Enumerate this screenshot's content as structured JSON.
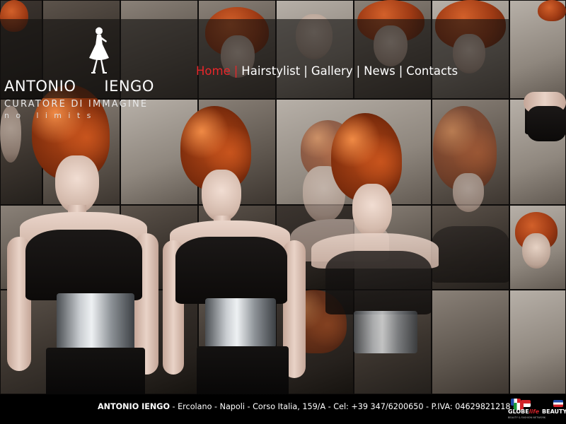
{
  "brand": {
    "name_first": "ANTONIO",
    "name_last": "IENGO",
    "tagline": "CURATORE DI IMMAGINE",
    "subtagline": "no limits"
  },
  "nav": {
    "items": [
      {
        "label": "Home",
        "active": true
      },
      {
        "label": "Hairstylist",
        "active": false
      },
      {
        "label": "Gallery",
        "active": false
      },
      {
        "label": "News",
        "active": false
      },
      {
        "label": "Contacts",
        "active": false
      }
    ],
    "separator": "|",
    "active_color": "#e8262a"
  },
  "footer": {
    "name": "ANTONIO IENGO",
    "address": " - Ercolano - Napoli - Corso Italia, 159/A - Cel: +39 347/6200650 - P.IVA: 04629821218 -",
    "partners": [
      {
        "label_a": "GLOBE",
        "label_b": "life",
        "sub": "BEAUTY & FASHION NETWORK"
      },
      {
        "label_a": "BEAUTY",
        "label_b": "",
        "sub": ""
      }
    ]
  },
  "icons": {
    "logo": "dancing-woman-silhouette-icon"
  },
  "colors": {
    "accent": "#e8262a",
    "header_band": "rgba(20,18,16,0.62)",
    "footer_bg": "#000000",
    "hair": "#b44817"
  }
}
